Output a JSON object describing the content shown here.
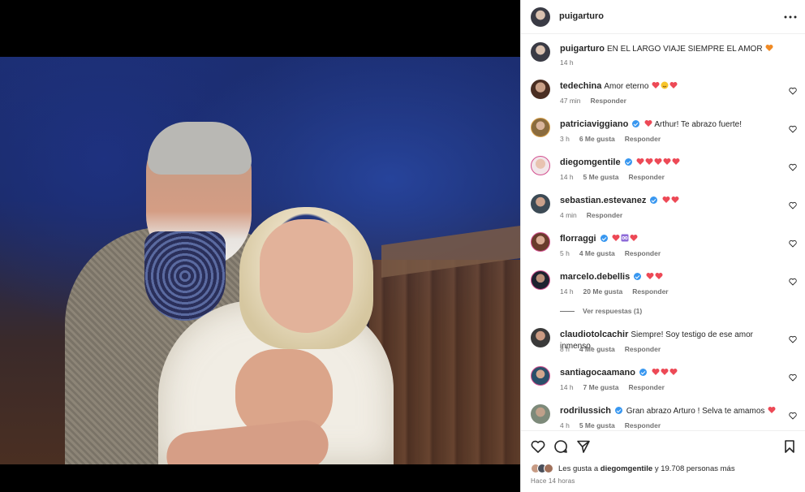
{
  "post": {
    "username": "puigarturo",
    "caption": "EN EL LARGO VIAJE SIEMPRE EL AMOR",
    "caption_time": "14 h",
    "likes_prefix": "Les gusta a",
    "likes_user": "diegomgentile",
    "likes_suffix": "y 19.708 personas más",
    "posted": "Hace 14 horas"
  },
  "ui": {
    "reply_label": "Responder",
    "view_replies": "Ver respuestas (1)"
  },
  "comments": [
    {
      "user": "tedechina",
      "verified": false,
      "text": "Amor eterno",
      "emojis": [
        "heart",
        "face",
        "heart"
      ],
      "time": "47 min",
      "likes": ""
    },
    {
      "user": "patriciaviggiano",
      "verified": true,
      "text": "Arthur! Te abrazo fuerte!",
      "emojis_before": [
        "heart"
      ],
      "time": "3 h",
      "likes": "6 Me gusta"
    },
    {
      "user": "diegomgentile",
      "verified": true,
      "text": "",
      "emojis": [
        "heart",
        "heart",
        "heart",
        "heart",
        "heart"
      ],
      "time": "14 h",
      "likes": "5 Me gusta"
    },
    {
      "user": "sebastian.estevanez",
      "verified": true,
      "text": "",
      "emojis": [
        "heart",
        "heart"
      ],
      "time": "4 min",
      "likes": ""
    },
    {
      "user": "florraggi",
      "verified": true,
      "text": "",
      "emojis": [
        "heart",
        "infinity",
        "heart"
      ],
      "time": "5 h",
      "likes": "4 Me gusta"
    },
    {
      "user": "marcelo.debellis",
      "verified": true,
      "text": "",
      "emojis": [
        "heart",
        "heart"
      ],
      "time": "14 h",
      "likes": "20 Me gusta"
    },
    {
      "user": "claudiotolcachir",
      "verified": false,
      "text": "Siempre! Soy testigo de ese amor inmenso.",
      "emojis": [],
      "time": "8 h",
      "likes": "4 Me gusta"
    },
    {
      "user": "santiagocaamano",
      "verified": true,
      "text": "",
      "emojis": [
        "heart",
        "heart",
        "heart"
      ],
      "time": "14 h",
      "likes": "7 Me gusta"
    },
    {
      "user": "rodrilussich",
      "verified": true,
      "text": "Gran abrazo Arturo ! Selva te amamos",
      "emojis": [
        "heart"
      ],
      "time": "4 h",
      "likes": "5 Me gusta"
    }
  ],
  "colors": {
    "heart": "#ed4956",
    "verified": "#3897f0",
    "muted": "#737373"
  }
}
